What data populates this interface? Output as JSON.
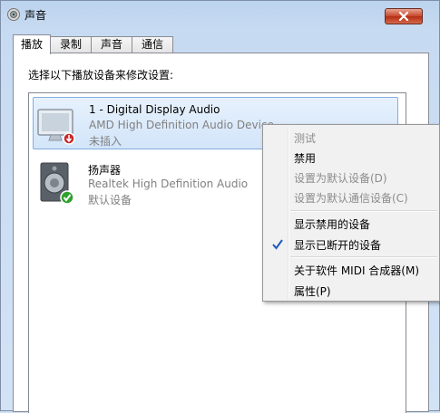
{
  "window": {
    "title": "声音",
    "icon": "speaker-icon",
    "close_icon": "close-icon"
  },
  "tabs": [
    {
      "label": "播放",
      "active": true
    },
    {
      "label": "录制",
      "active": false
    },
    {
      "label": "声音",
      "active": false
    },
    {
      "label": "通信",
      "active": false
    }
  ],
  "panel": {
    "instruction": "选择以下播放设备来修改设置:"
  },
  "devices": [
    {
      "name": "1 - Digital Display Audio",
      "driver": "AMD High Definition Audio Device",
      "status": "未插入",
      "icon": "monitor-icon",
      "badge": "unplugged-badge",
      "selected": true
    },
    {
      "name": "扬声器",
      "driver": "Realtek High Definition Audio",
      "status": "默认设备",
      "icon": "speaker-icon",
      "badge": "default-check-badge",
      "selected": false
    }
  ],
  "context_menu": {
    "items": [
      {
        "label": "测试",
        "enabled": false
      },
      {
        "label": "禁用",
        "enabled": true
      },
      {
        "label": "设置为默认设备(D)",
        "enabled": false
      },
      {
        "label": "设置为默认通信设备(C)",
        "enabled": false
      },
      {
        "label": "显示禁用的设备",
        "enabled": true
      },
      {
        "label": "显示已断开的设备",
        "enabled": true,
        "checked": true
      },
      {
        "label": "关于软件 MIDI 合成器(M)",
        "enabled": true
      },
      {
        "label": "属性(P)",
        "enabled": true
      }
    ]
  },
  "colors": {
    "selection_border": "#84acdd",
    "check_color": "#1e5bbd",
    "default_badge": "#2fa12f",
    "unplugged_badge": "#c8282b"
  }
}
